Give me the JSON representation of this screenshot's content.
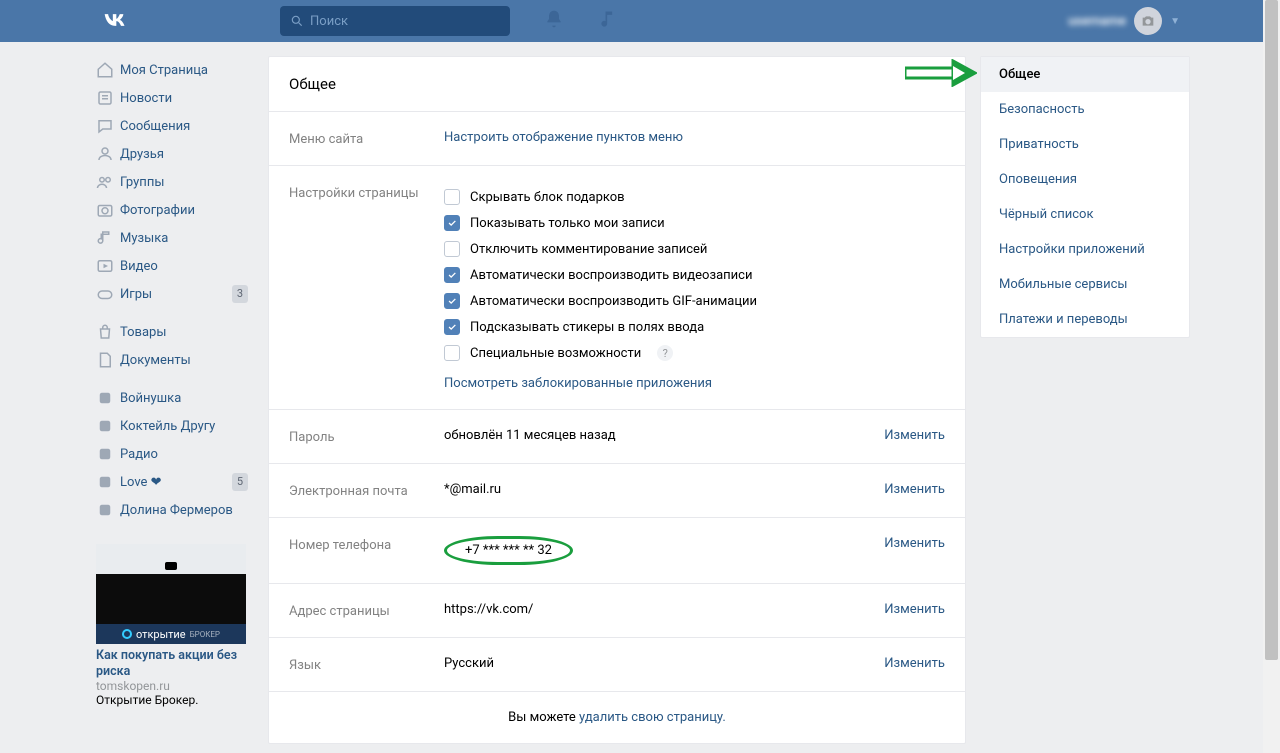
{
  "header": {
    "search_placeholder": "Поиск",
    "username": "username"
  },
  "left_nav": {
    "items": [
      {
        "icon": "home",
        "label": "Моя Страница"
      },
      {
        "icon": "news",
        "label": "Новости"
      },
      {
        "icon": "msg",
        "label": "Сообщения"
      },
      {
        "icon": "friends",
        "label": "Друзья"
      },
      {
        "icon": "groups",
        "label": "Группы"
      },
      {
        "icon": "photos",
        "label": "Фотографии"
      },
      {
        "icon": "music",
        "label": "Музыка"
      },
      {
        "icon": "video",
        "label": "Видео"
      },
      {
        "icon": "games",
        "label": "Игры",
        "badge": "3"
      }
    ],
    "items2": [
      {
        "icon": "bag",
        "label": "Товары"
      },
      {
        "icon": "doc",
        "label": "Документы"
      }
    ],
    "items3": [
      {
        "icon": "app",
        "label": "Войнушка"
      },
      {
        "icon": "app",
        "label": "Коктейль Другу"
      },
      {
        "icon": "app",
        "label": "Радио"
      },
      {
        "icon": "app",
        "label": "Love ❤",
        "badge": "5"
      },
      {
        "icon": "app",
        "label": "Долина Фермеров"
      }
    ]
  },
  "ad": {
    "brand": "открытие",
    "brand_suffix": "БРОКЕР",
    "title": "Как покупать акции без риска",
    "domain": "tomskopen.ru",
    "desc": "Открытие Брокер."
  },
  "main": {
    "title": "Общее",
    "menu_section": {
      "label": "Меню сайта",
      "link": "Настроить отображение пунктов меню"
    },
    "page_settings": {
      "label": "Настройки страницы",
      "checks": [
        {
          "checked": false,
          "text": "Скрывать блок подарков"
        },
        {
          "checked": true,
          "text": "Показывать только мои записи"
        },
        {
          "checked": false,
          "text": "Отключить комментирование записей"
        },
        {
          "checked": true,
          "text": "Автоматически воспроизводить видеозаписи"
        },
        {
          "checked": true,
          "text": "Автоматически воспроизводить GIF-анимации"
        },
        {
          "checked": true,
          "text": "Подсказывать стикеры в полях ввода"
        },
        {
          "checked": false,
          "text": "Специальные возможности",
          "help": true
        }
      ],
      "blocked_link": "Посмотреть заблокированные приложения"
    },
    "rows": {
      "password": {
        "label": "Пароль",
        "value": "обновлён 11 месяцев назад",
        "action": "Изменить"
      },
      "email": {
        "label": "Электронная почта",
        "value": "*@mail.ru",
        "action": "Изменить"
      },
      "phone": {
        "label": "Номер телефона",
        "value": "+7 *** *** ** 32",
        "action": "Изменить"
      },
      "address": {
        "label": "Адрес страницы",
        "value": "https://vk.com/",
        "action": "Изменить"
      },
      "lang": {
        "label": "Язык",
        "value": "Русский",
        "action": "Изменить"
      }
    },
    "footer": {
      "prefix": "Вы можете ",
      "link": "удалить свою страницу."
    }
  },
  "right": {
    "items": [
      "Общее",
      "Безопасность",
      "Приватность",
      "Оповещения",
      "Чёрный список",
      "Настройки приложений",
      "Мобильные сервисы",
      "Платежи и переводы"
    ]
  }
}
